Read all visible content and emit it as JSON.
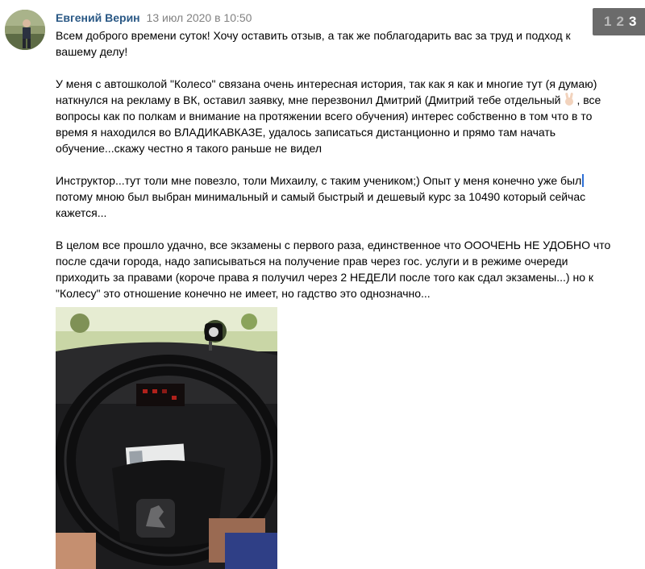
{
  "post": {
    "author": "Евгений Верин",
    "date": "13 июл 2020 в 10:50",
    "paragraphs": [
      "Всем доброго времени суток! Хочу оставить отзыв, а так же поблагодарить вас за труд и подход к вашему делу!",
      "У меня с автошколой \"Колесо\" связана очень интересная история, так как я как и многие тут (я думаю) наткнулся на рекламу в ВК, оставил заявку, мне перезвонил Дмитрий (Дмитрий тебе отдельный",
      ", все вопросы как по полкам и внимание на протяжении всего обучения) интерес собственно в том что в то время я находился во ВЛАДИКАВКАЗЕ, удалось записаться дистанционно и прямо там начать обучение...скажу честно я такого раньше не видел",
      "Инструктор...тут толи мне повезло, толи Михаилу, с таким учеником;) Опыт у меня конечно уже был",
      "потому мною был выбран минимальный и самый быстрый и дешевый курс за 10490 который сейчас кажется...",
      "В целом все прошло удачно, все экзамены с первого раза, единственное что ОООЧЕНЬ НЕ УДОБНО что после сдачи города, надо записываться на получение прав через гос. услуги и в режиме очереди приходить за правами (короче права я получил через 2 НЕДЕЛИ после того как сдал экзамены...) но к \"Колесу\" это отношение конечно не имеет, но гадство это однозначно..."
    ],
    "emoji": "victory-hand-emoji",
    "photo": "car-steering-wheel-photo"
  },
  "pager": {
    "pages": [
      "1",
      "2",
      "3"
    ],
    "current": "3"
  },
  "colors": {
    "author": "#2a5885",
    "date": "#828282",
    "pager_bg": "#6b6b6b"
  }
}
